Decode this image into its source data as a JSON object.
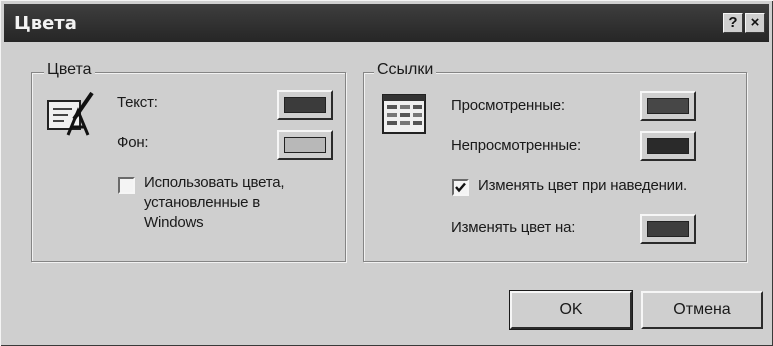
{
  "window": {
    "title": "Цвета",
    "help_glyph": "?",
    "close_glyph": "×"
  },
  "colors_group": {
    "label": "Цвета",
    "text_label": "Текст:",
    "text_color": "#3b3b3b",
    "bg_label": "Фон:",
    "bg_color": "#b8b8b8",
    "use_windows_line1": "Использовать цвета,",
    "use_windows_line2": "установленные в",
    "use_windows_line3": "Windows",
    "use_windows_checked": false
  },
  "links_group": {
    "label": "Ссылки",
    "visited_label": "Просмотренные:",
    "visited_color": "#474747",
    "unvisited_label": "Непросмотренные:",
    "unvisited_color": "#2a2a2a",
    "hover_label": "Изменять цвет при наведении.",
    "hover_checked": true,
    "hover_color_label": "Изменять цвет на:",
    "hover_color": "#3e3e3e"
  },
  "buttons": {
    "ok": "OK",
    "cancel": "Отмена"
  }
}
